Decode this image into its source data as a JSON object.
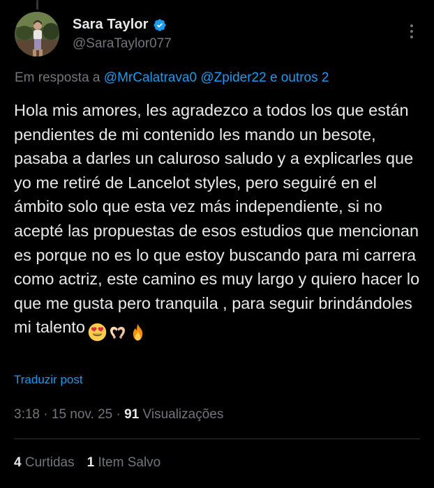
{
  "author": {
    "display_name": "Sara Taylor",
    "handle": "@SaraTaylor077",
    "verified_icon": "verified-badge-icon",
    "verified_color": "#1d9bf0"
  },
  "reply": {
    "prefix": "Em resposta a",
    "mention_1": "@MrCalatrava0",
    "mention_2": "@Zpider22",
    "suffix": "e outros 2"
  },
  "tweet": {
    "text": "Hola mis amores, les agradezco a todos los que están pendientes de mi contenido les mando un besote, pasaba a darles un caluroso saludo y a explicarles que yo me retiré de Lancelot styles, pero seguiré en el ámbito solo que esta vez más independiente, si no acepté las propuestas de esos estudios que mencionan es porque no es lo que estoy buscando para mi carrera como actriz, este camino es muy largo y quiero hacer lo que me gusta pero tranquila , para seguir brindándoles mi talento",
    "emojis": [
      "heart-eyes-emoji",
      "heart-hands-emoji",
      "fire-emoji"
    ]
  },
  "translate_label": "Traduzir post",
  "meta": {
    "time": "3:18",
    "date": "15 nov. 25",
    "separator": "·",
    "views_count": "91",
    "views_label": "Visualizações"
  },
  "stats": {
    "reposts_count": "4",
    "reposts_label": "Curtidas",
    "bookmarks_count": "1",
    "bookmarks_label": "Item Salvo"
  },
  "colors": {
    "background": "#000000",
    "text_primary": "#e7e9ea",
    "text_secondary": "#71767b",
    "accent": "#1d9bf0",
    "divider": "#2f3336"
  }
}
